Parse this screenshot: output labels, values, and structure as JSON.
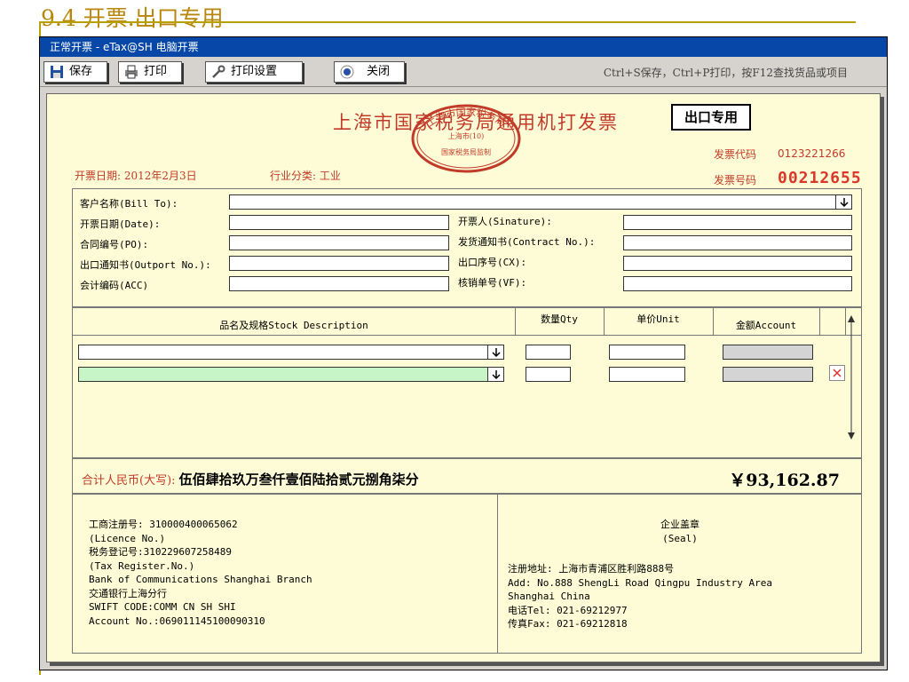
{
  "slide": {
    "title": "9.4 开票.出口专用"
  },
  "window": {
    "title": "正常开票 - eTax@SH 电脑开票"
  },
  "toolbar": {
    "save_label": "保存",
    "print_label": "打印",
    "print_settings_label": "打印设置",
    "close_label": "关闭",
    "hint": "Ctrl+S保存，Ctrl+P打印，按F12查找货品或项目"
  },
  "invoice": {
    "title": "上海市国家税务局通用机打发票",
    "export_badge": "出口专用",
    "seal": {
      "top": "上海市国家税务局",
      "middle": "上海市(10)",
      "bottom": "国家税务局监制"
    },
    "code_label": "发票代码",
    "code_value": "0123221266",
    "number_label": "发票号码",
    "number_value": "00212655",
    "issue_date_text": "开票日期: 2012年2月3日",
    "industry_text": "行业分类: 工业"
  },
  "form": {
    "customer_label": "客户名称(Bill To):",
    "date_label": "开票日期(Date):",
    "po_label": "合同编号(PO):",
    "outport_label": "出口通知书(Outport No.):",
    "acc_label": "会计编码(ACC)",
    "sinature_label": "开票人(Sinature):",
    "contract_label": "发货通知书(Contract No.):",
    "cx_label": "出口序号(CX):",
    "vf_label": "核销单号(VF):"
  },
  "goods": {
    "headers": {
      "description": "品名及规格Stock Description",
      "qty": "数量Qty",
      "unit": "单价Unit",
      "amount": "金额Account"
    }
  },
  "totals": {
    "label": "合计人民币(大写):",
    "words": "伍佰肆拾玖万叁仟壹佰陆拾贰元捌角柒分",
    "amount": "￥93,162.87"
  },
  "footer": {
    "left_lines": [
      "工商注册号: 310000400065062",
      "(Licence No.)",
      "税务登记号:310229607258489",
      "(Tax Register.No.)",
      "Bank of Communications Shanghai Branch",
      "交通银行上海分行",
      "SWIFT CODE:COMM CN SH SHI",
      "Account No.:069011145100090310"
    ],
    "seal_label": "企业盖章",
    "seal_label_en": "(Seal)",
    "right_lines": [
      "注册地址: 上海市青浦区胜利路888号",
      "Add: No.888 ShengLi Road Qingpu Industry Area",
      "Shanghai China",
      "电话Tel: 021-69212977",
      "传真Fax: 021-69212818"
    ]
  },
  "colors": {
    "titlebar": "#0747a8",
    "invoice_bg": "#fdfcd6",
    "accent_red": "#c23a2a",
    "slide_title": "#b8860b",
    "row_highlight": "#c8f5c8"
  }
}
